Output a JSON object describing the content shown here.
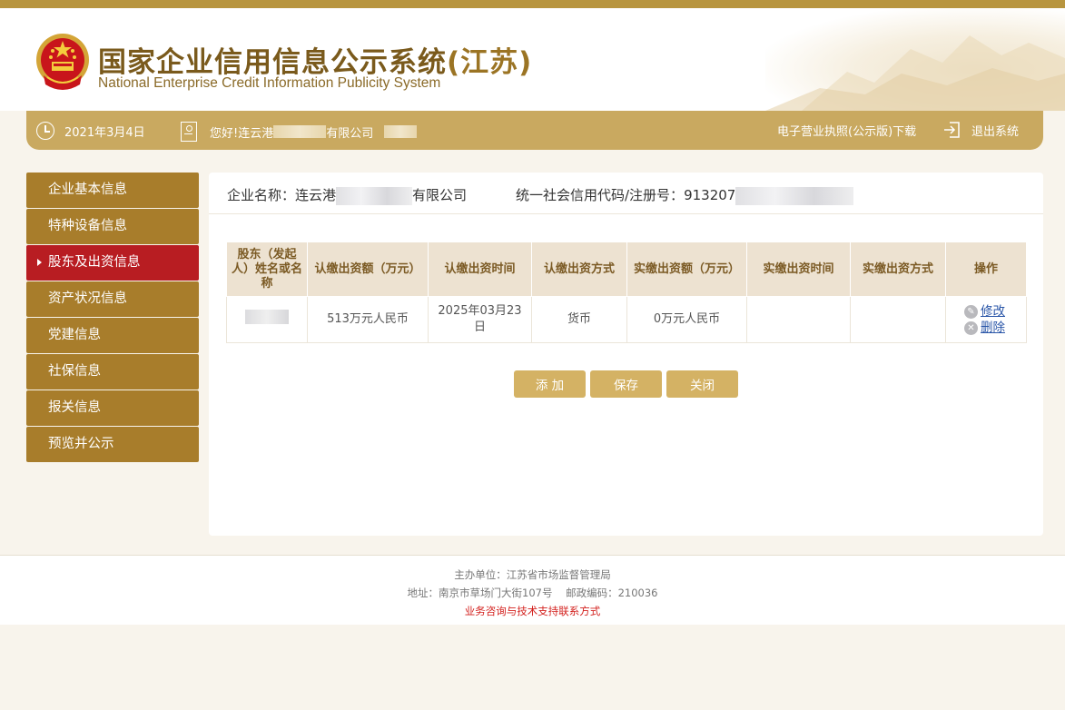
{
  "header": {
    "title": "国家企业信用信息公示系统",
    "province": "(江苏)",
    "subtitle": "National Enterprise Credit Information Publicity System"
  },
  "userbar": {
    "date": "2021年3月4日",
    "greeting_prefix": "您好!连云港",
    "greeting_suffix": "有限公司",
    "license_download": "电子营业执照(公示版)下载",
    "logout": "退出系统"
  },
  "sidebar": {
    "items": [
      {
        "label": "企业基本信息",
        "active": false
      },
      {
        "label": "特种设备信息",
        "active": false
      },
      {
        "label": "股东及出资信息",
        "active": true
      },
      {
        "label": "资产状况信息",
        "active": false
      },
      {
        "label": "党建信息",
        "active": false
      },
      {
        "label": "社保信息",
        "active": false
      },
      {
        "label": "报关信息",
        "active": false
      },
      {
        "label": "预览并公示",
        "active": false
      }
    ]
  },
  "company": {
    "name_label": "企业名称：",
    "name_prefix": "连云港",
    "name_suffix": "有限公司",
    "code_label": "统一社会信用代码/注册号：",
    "code_prefix": "913207"
  },
  "table": {
    "headers": [
      "股东（发起人）姓名或名称",
      "认缴出资额（万元）",
      "认缴出资时间",
      "认缴出资方式",
      "实缴出资额（万元）",
      "实缴出资时间",
      "实缴出资方式",
      "操作"
    ],
    "rows": [
      {
        "subscribed_amount": "513万元人民币",
        "subscribed_date": "2025年03月23日",
        "subscribed_method": "货币",
        "paid_amount": "0万元人民币",
        "paid_date": "",
        "paid_method": "",
        "edit_label": "修改",
        "delete_label": "删除"
      }
    ]
  },
  "buttons": {
    "add": "添 加",
    "save": "保存",
    "close": "关闭"
  },
  "footer": {
    "host": "主办单位：江苏省市场监督管理局",
    "address": "地址：南京市草场门大街107号    邮政编码：210036",
    "contact": "业务咨询与技术支持联系方式"
  },
  "colors": {
    "gold": "#a87d2b",
    "bar": "#c9a960",
    "active_red": "#b81d22",
    "button": "#d4b264"
  }
}
